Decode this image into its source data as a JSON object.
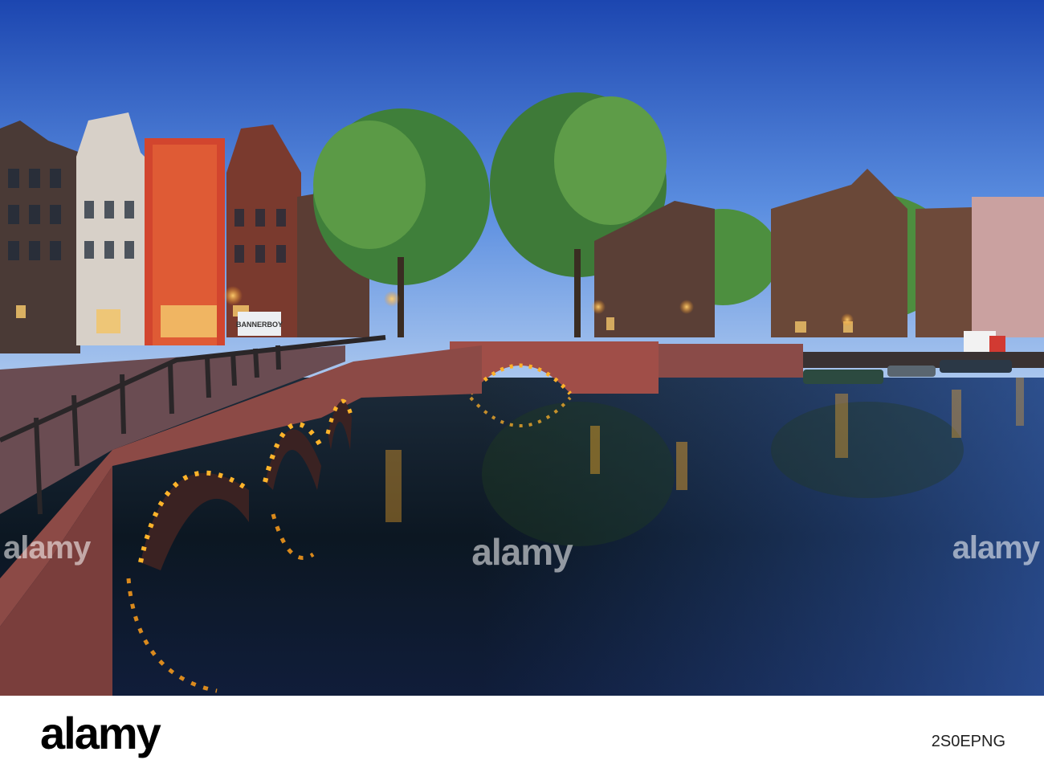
{
  "photo": {
    "description_icon": "canal-bridge-photo",
    "sign_text": "BANNERBOY"
  },
  "watermark": {
    "text": "alamy",
    "colors": {
      "overlay": "#ffffff"
    }
  },
  "footer": {
    "logo": "alamy",
    "image_id": "2S0EPNG"
  },
  "colors": {
    "sky_top": "#1f4fb8",
    "sky_bottom": "#8eb6ea",
    "water": "#0d1a26",
    "lights": "#ffb020",
    "brick": "#a8504a"
  }
}
